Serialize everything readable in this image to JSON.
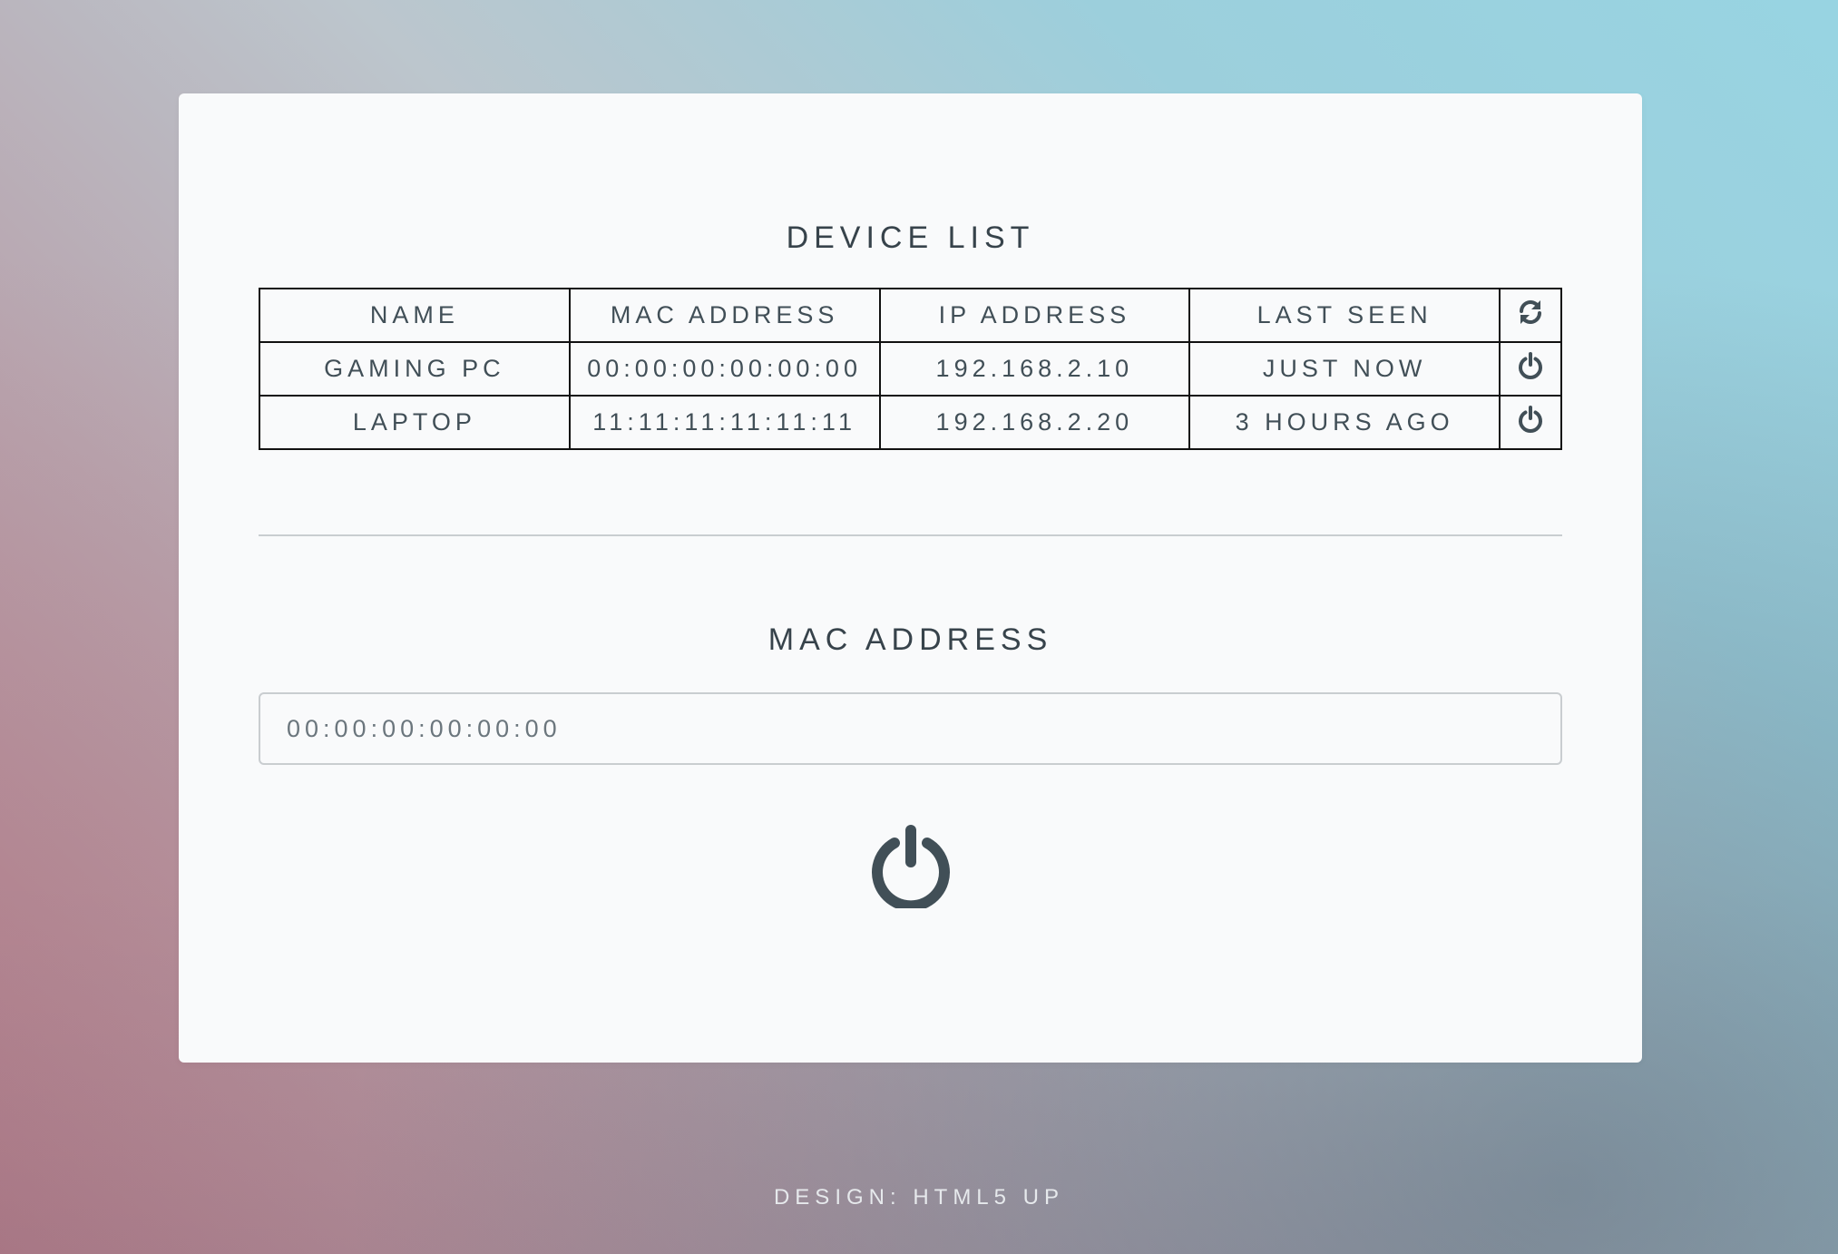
{
  "device_list": {
    "title": "DEVICE LIST",
    "columns": [
      "NAME",
      "MAC ADDRESS",
      "IP ADDRESS",
      "LAST SEEN"
    ],
    "header_icon": "refresh-icon",
    "rows": [
      {
        "name": "GAMING PC",
        "mac": "00:00:00:00:00:00",
        "ip": "192.168.2.10",
        "last_seen": "JUST NOW",
        "icon": "power-icon"
      },
      {
        "name": "LAPTOP",
        "mac": "11:11:11:11:11:11",
        "ip": "192.168.2.20",
        "last_seen": "3 HOURS AGO",
        "icon": "power-icon"
      }
    ]
  },
  "mac_form": {
    "title": "MAC ADDRESS",
    "placeholder": "00:00:00:00:00:00",
    "value": "",
    "submit_icon": "power-icon"
  },
  "footer": {
    "text": "DESIGN: HTML5 UP"
  },
  "colors": {
    "panel": "#f9fafb",
    "text": "#414f57",
    "icon": "#414f57",
    "table_border": "#111111",
    "divider": "#c9cdd0"
  }
}
